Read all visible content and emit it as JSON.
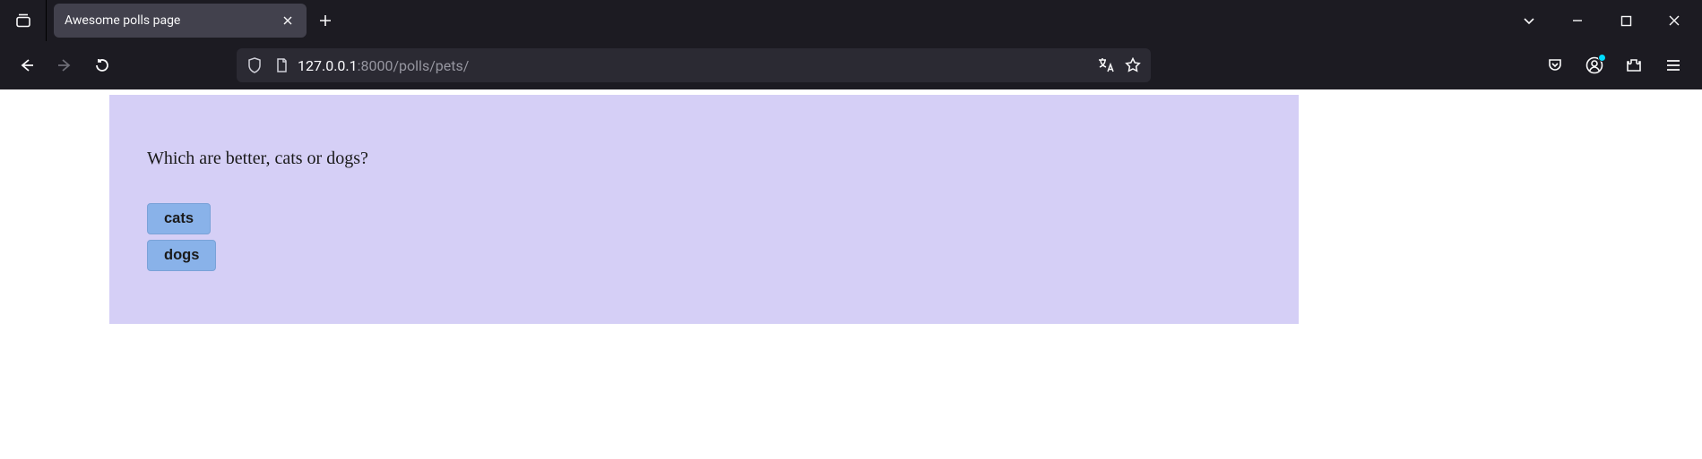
{
  "browser": {
    "tab_title": "Awesome polls page",
    "url": {
      "host": "127.0.0.1",
      "port": ":8000",
      "path": "/polls/pets/"
    }
  },
  "page": {
    "question": "Which are better, cats or dogs?",
    "options": [
      "cats",
      "dogs"
    ]
  }
}
